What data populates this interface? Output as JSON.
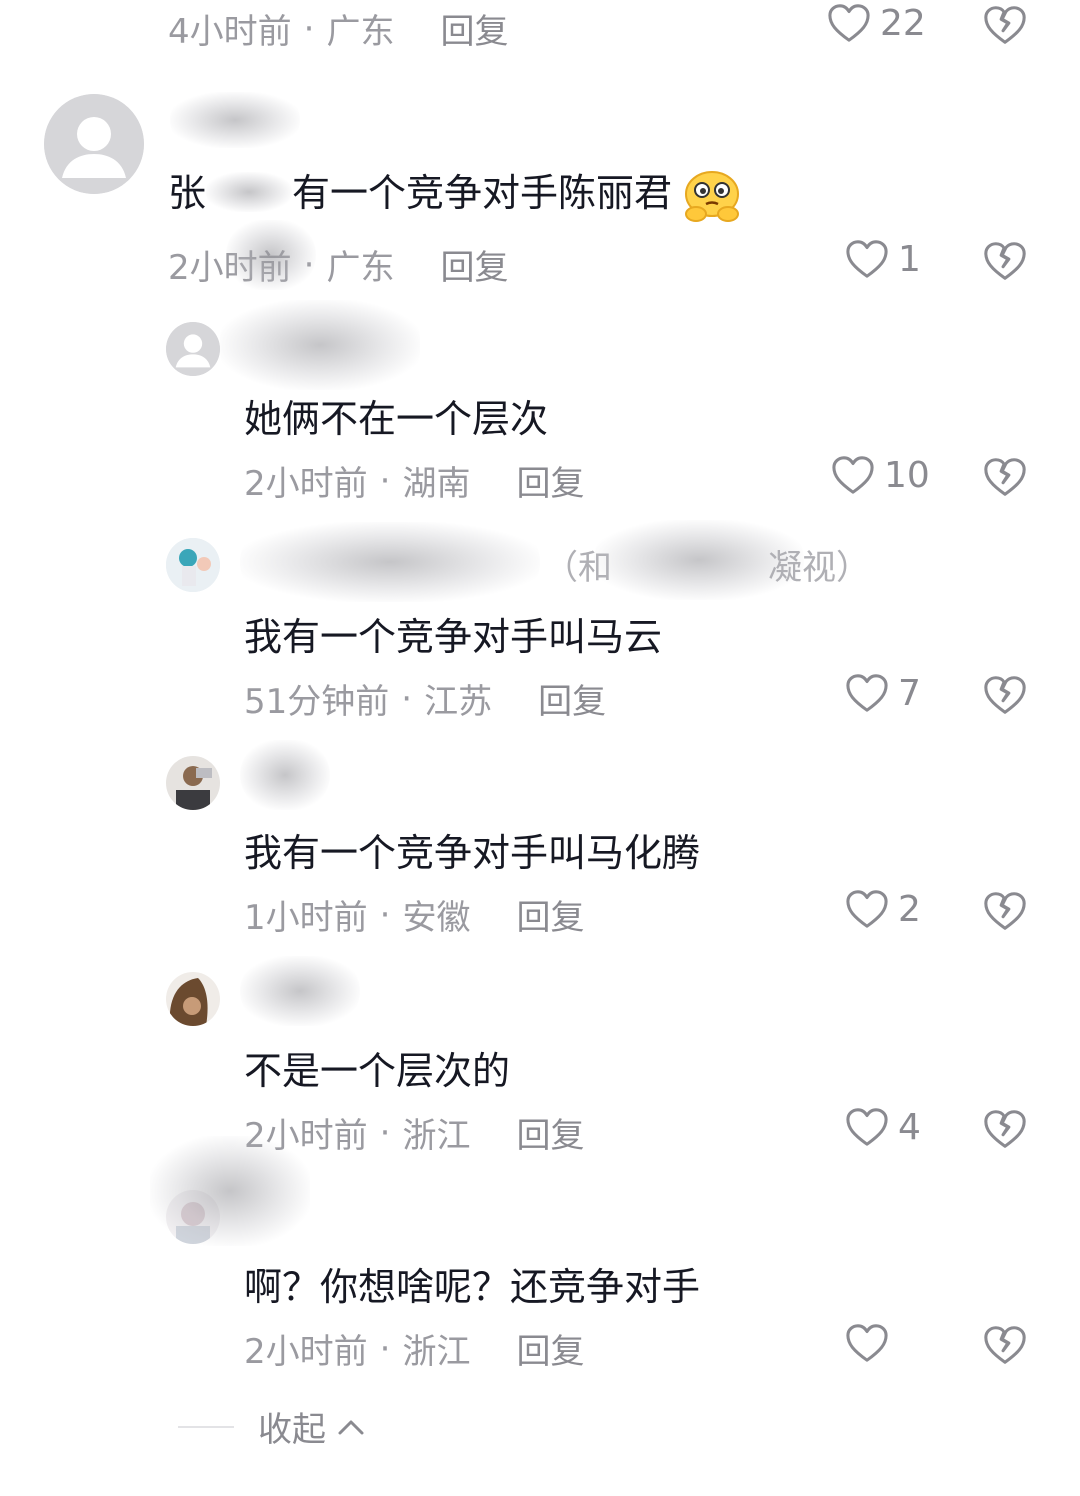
{
  "reply_label": "回复",
  "collapse_label": "收起",
  "comments": [
    {
      "id": "c0",
      "time": "4小时前",
      "location": "广东",
      "likes": "22"
    },
    {
      "id": "c1",
      "text_prefix": "张",
      "text_rest": "有一个竞争对手陈丽君",
      "time": "2小时前",
      "location": "广东",
      "likes": "1"
    },
    {
      "id": "r1",
      "text": "她俩不在一个层次",
      "time": "2小时前",
      "location": "湖南",
      "likes": "10"
    },
    {
      "id": "r2",
      "nickname_tail": "（和",
      "nickname_end": "凝视）",
      "text": "我有一个竞争对手叫马云",
      "time": "51分钟前",
      "location": "江苏",
      "likes": "7"
    },
    {
      "id": "r3",
      "text": "我有一个竞争对手叫马化腾",
      "time": "1小时前",
      "location": "安徽",
      "likes": "2"
    },
    {
      "id": "r4",
      "text": "不是一个层次的",
      "time": "2小时前",
      "location": "浙江",
      "likes": "4"
    },
    {
      "id": "r5",
      "text": "啊？你想啥呢？还竞争对手",
      "time": "2小时前",
      "location": "浙江",
      "likes": ""
    }
  ]
}
